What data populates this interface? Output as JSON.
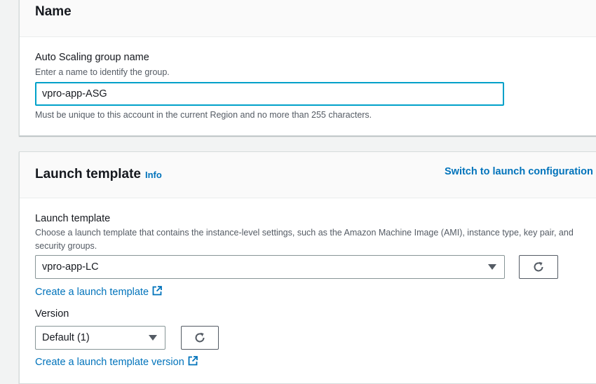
{
  "name_section": {
    "title": "Name",
    "field_label": "Auto Scaling group name",
    "field_description": "Enter a name to identify the group.",
    "field_value": "vpro-app-ASG",
    "field_constraint": "Must be unique to this account in the current Region and no more than 255 characters."
  },
  "launch_template_section": {
    "title": "Launch template",
    "info_link": "Info",
    "switch_link": "Switch to launch configuration",
    "template_label": "Launch template",
    "template_description": "Choose a launch template that contains the instance-level settings, such as the Amazon Machine Image (AMI), instance type, key pair, and security groups.",
    "template_selected": "vpro-app-LC",
    "create_template_link": "Create a launch template",
    "version_label": "Version",
    "version_selected": "Default (1)",
    "create_version_link": "Create a launch template version"
  },
  "icons": {
    "refresh": "refresh-icon",
    "external_link": "external-link-icon",
    "dropdown": "caret-down-icon"
  },
  "colors": {
    "link": "#0073bb",
    "focus_border": "#00a1c9",
    "page_background": "#f2f3f3"
  }
}
